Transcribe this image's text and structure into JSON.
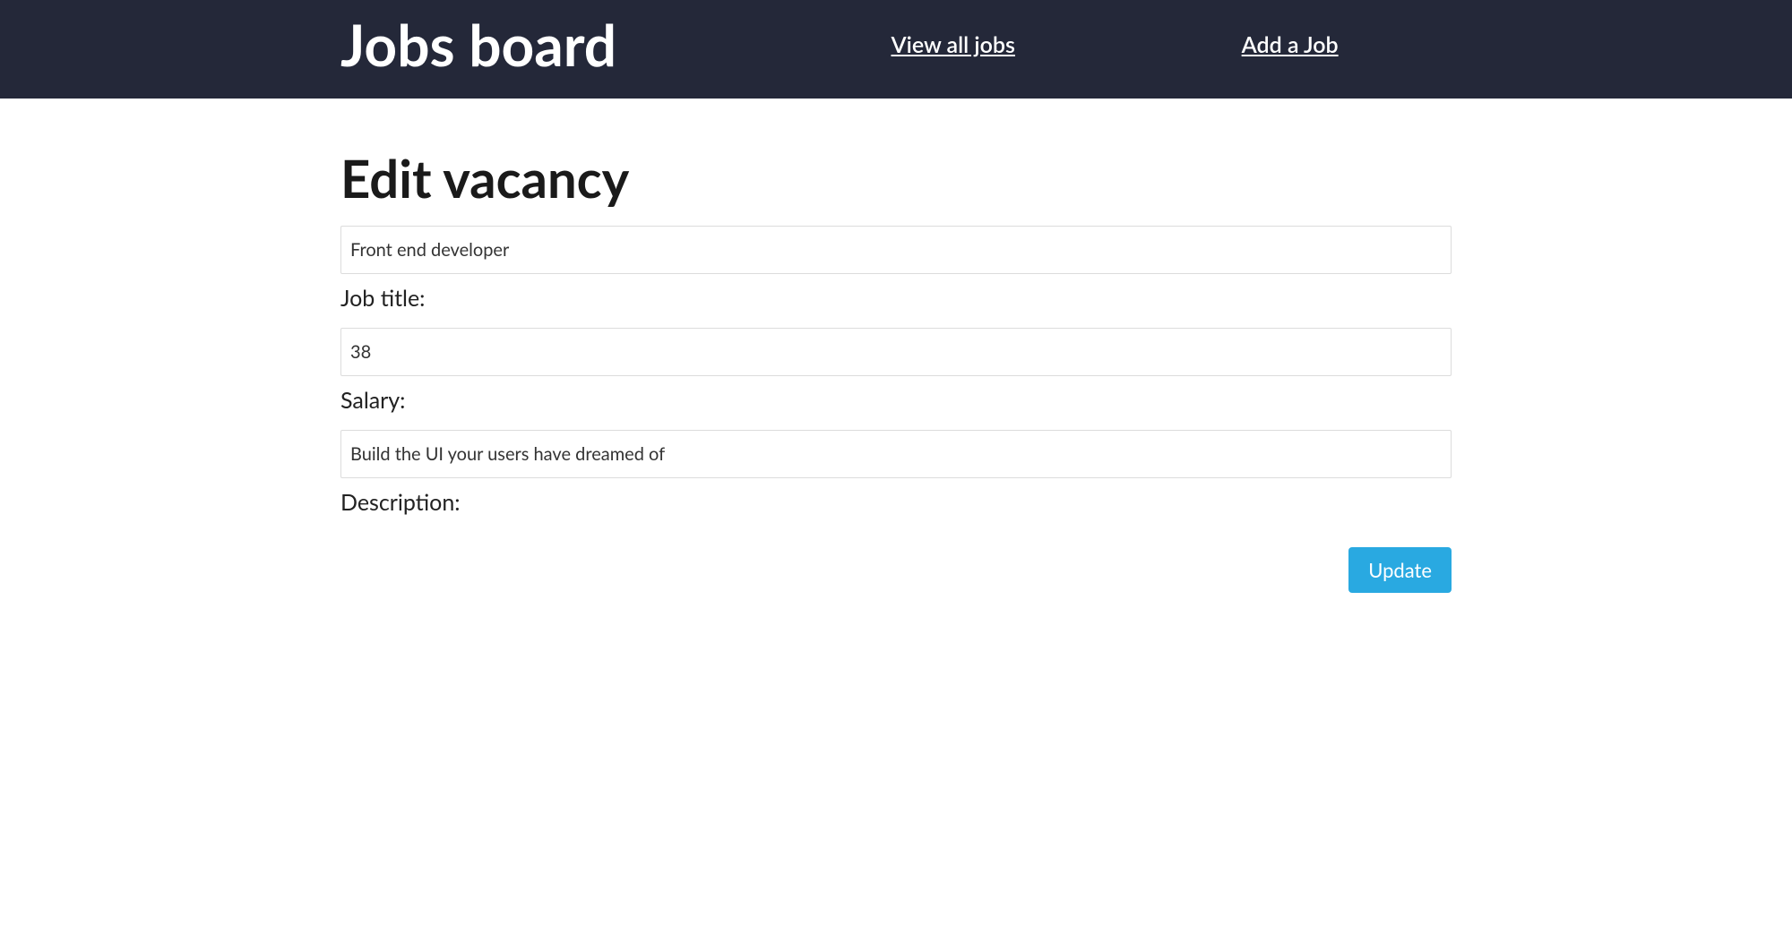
{
  "navbar": {
    "brand": "Jobs board",
    "links": {
      "view_all": "View all jobs",
      "add_job": "Add a Job"
    }
  },
  "page": {
    "title": "Edit vacancy"
  },
  "form": {
    "job_title_value": "Front end developer",
    "job_title_label": "Job title:",
    "salary_value": "38",
    "salary_label": "Salary:",
    "description_value": "Build the UI your users have dreamed of",
    "description_label": "Description:",
    "update_button": "Update"
  }
}
